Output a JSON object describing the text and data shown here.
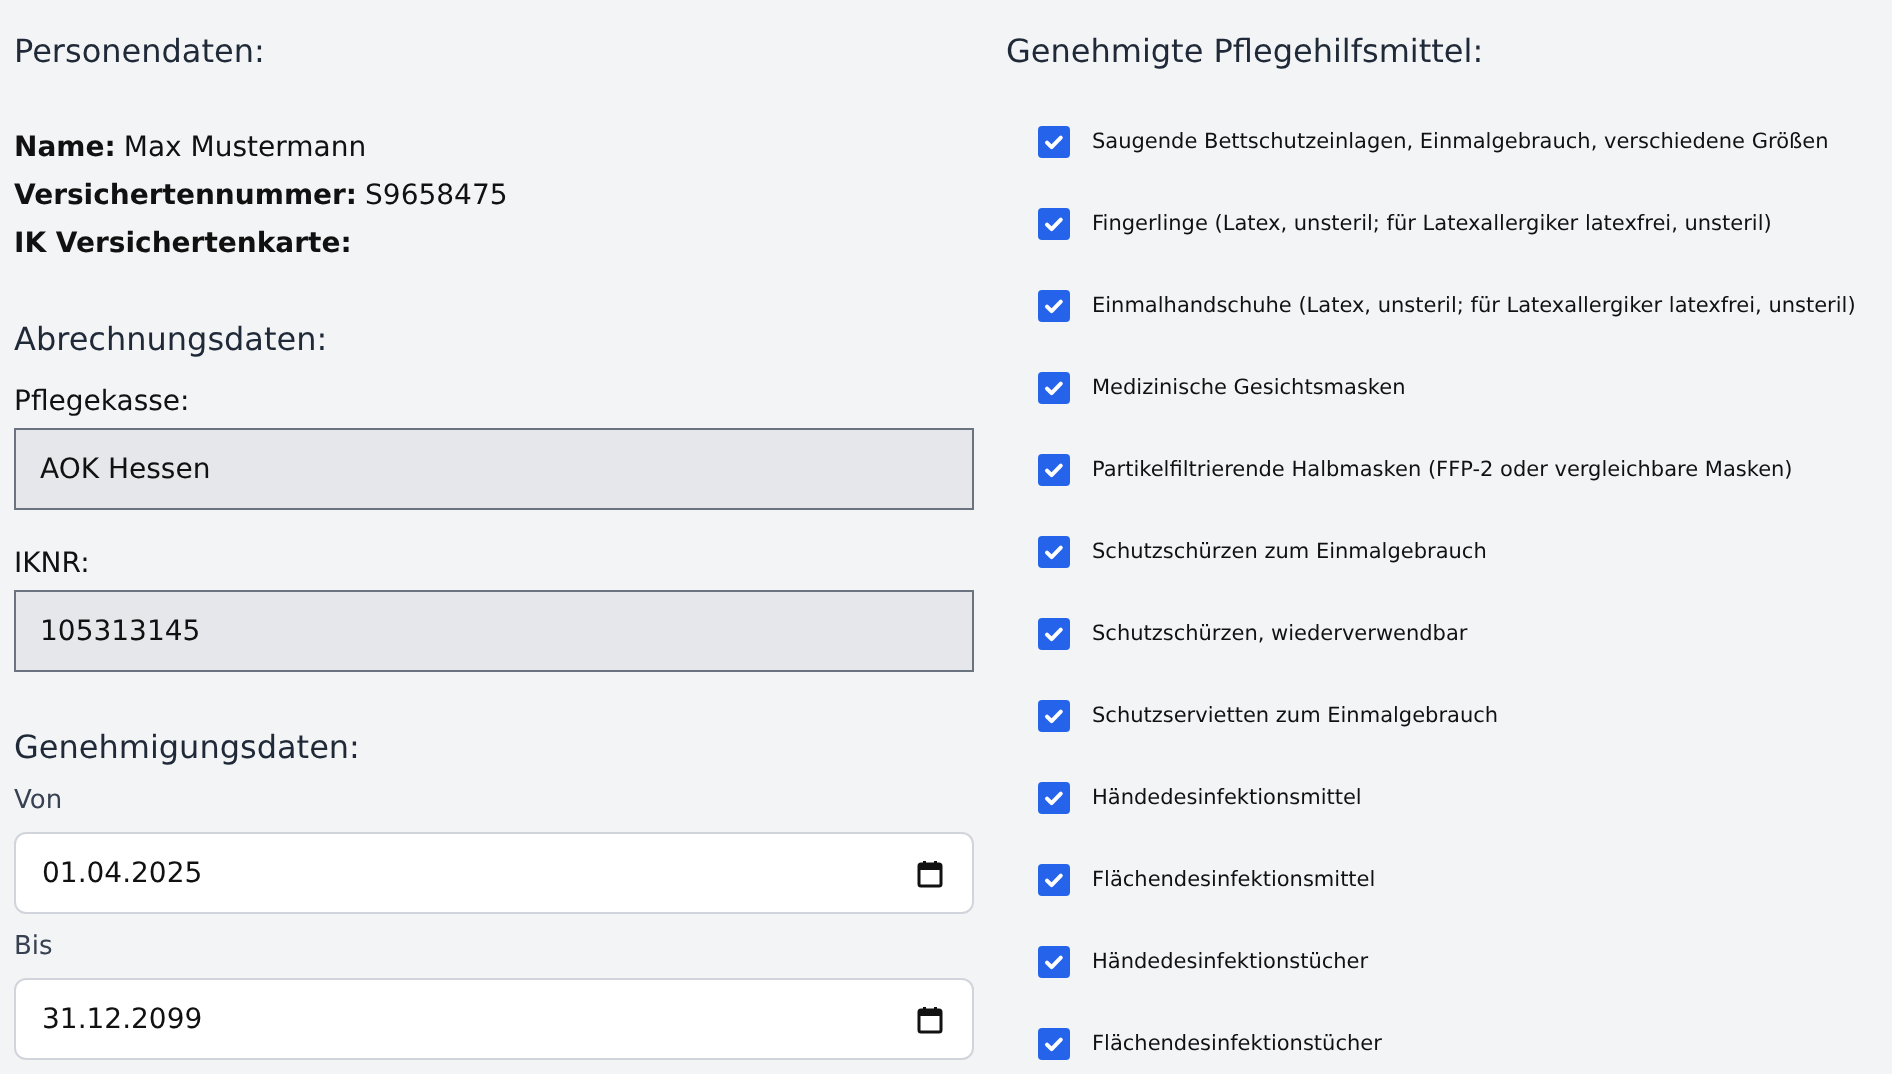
{
  "personal": {
    "heading": "Personendaten:",
    "fields": [
      {
        "label": "Name:",
        "value": "Max Mustermann"
      },
      {
        "label": "Versichertennummer:",
        "value": "S9658475"
      },
      {
        "label": "IK Versichertenkarte:"
      }
    ]
  },
  "billing": {
    "heading": "Abrechnungsdaten:",
    "fields": [
      {
        "label": "Pflegekasse:",
        "value": "AOK Hessen",
        "disabled": true
      },
      {
        "label": "IKNR:",
        "value": "105313145",
        "disabled": true
      }
    ]
  },
  "approval": {
    "heading": "Genehmigungsdaten:",
    "fields": [
      {
        "label": "Von",
        "value": "01.04.2025"
      },
      {
        "label": "Bis",
        "value": "31.12.2099"
      }
    ]
  },
  "aids": {
    "heading": "Genehmigte Pflegehilfsmittel:",
    "items": [
      {
        "label": "Saugende Bettschutzeinlagen, Einmalgebrauch, verschiedene Größen",
        "checked": true
      },
      {
        "label": "Fingerlinge (Latex, unsteril; für Latexallergiker latexfrei, unsteril)",
        "checked": true
      },
      {
        "label": "Einmalhandschuhe (Latex, unsteril; für Latexallergiker latexfrei, unsteril)",
        "checked": true
      },
      {
        "label": "Medizinische Gesichtsmasken",
        "checked": true
      },
      {
        "label": "Partikelfiltrierende Halbmasken (FFP-2 oder vergleichbare Masken)",
        "checked": true
      },
      {
        "label": "Schutzschürzen zum Einmalgebrauch",
        "checked": true
      },
      {
        "label": "Schutzschürzen, wiederverwendbar",
        "checked": true
      },
      {
        "label": "Schutzservietten zum Einmalgebrauch",
        "checked": true
      },
      {
        "label": "Händedesinfektionsmittel",
        "checked": true
      },
      {
        "label": "Flächendesinfektionsmittel",
        "checked": true
      },
      {
        "label": "Händedesinfektionstücher",
        "checked": true
      },
      {
        "label": "Flächendesinfektionstücher",
        "checked": true
      }
    ]
  }
}
